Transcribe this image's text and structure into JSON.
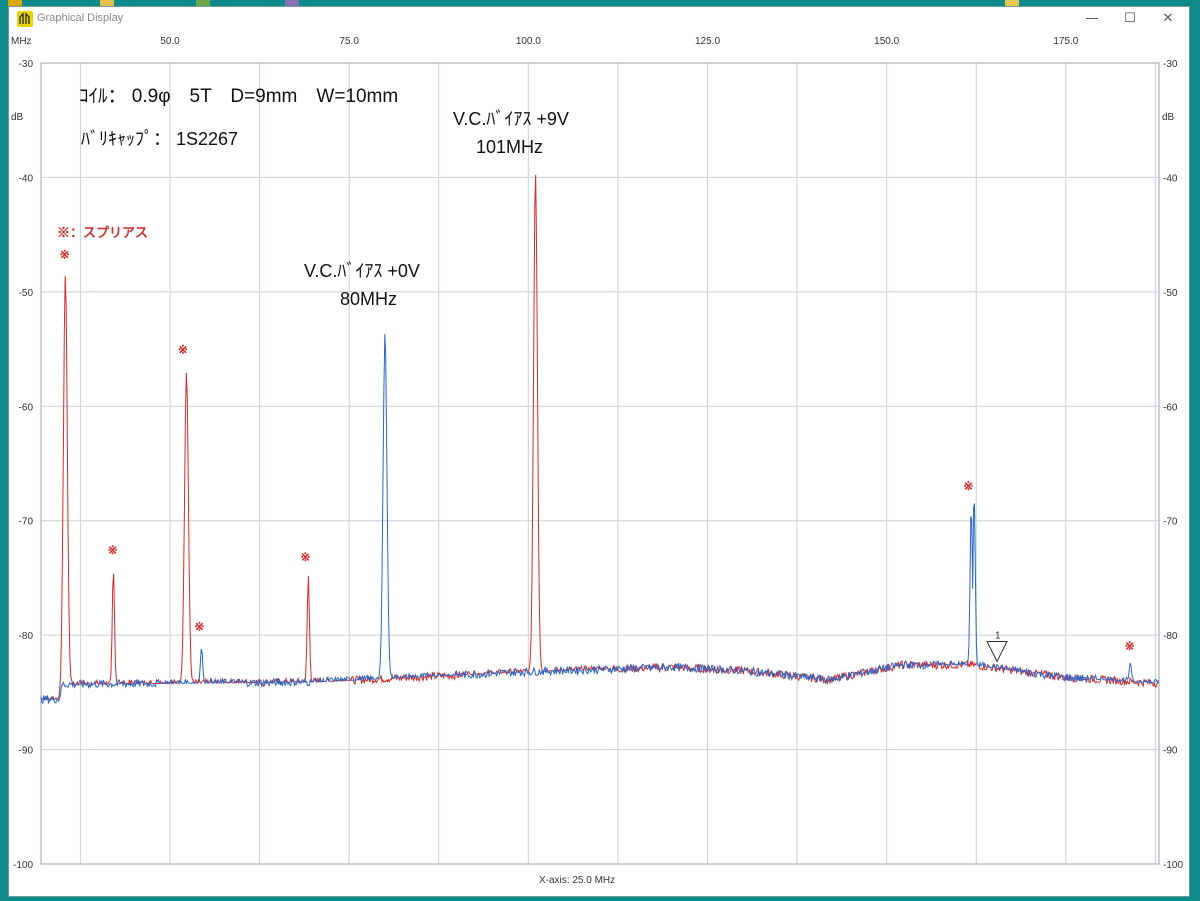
{
  "window": {
    "title": "Graphical Display",
    "minimize": "—",
    "maximize": "☐",
    "close": "✕"
  },
  "chart_data": {
    "type": "line",
    "x_unit": "MHz",
    "y_unit": "dB",
    "xlim": [
      32,
      188
    ],
    "ylim": [
      -100,
      -30
    ],
    "x_ticks": [
      50,
      75,
      100,
      125,
      150,
      175
    ],
    "x_tick_labels": [
      "50.0",
      "75.0",
      "100.0",
      "125.0",
      "150.0",
      "175.0"
    ],
    "y_ticks": [
      -30,
      -40,
      -50,
      -60,
      -70,
      -80,
      -90,
      -100
    ],
    "y_tick_labels": [
      "-30",
      "-40",
      "-50",
      "-60",
      "-70",
      "-80",
      "-90",
      "-100"
    ],
    "x_axis_label": "X-axis: 25.0 MHz",
    "grid": true,
    "series": [
      {
        "color": "#d42a2a",
        "noise_floor": [
          [
            32,
            -85.6
          ],
          [
            34.5,
            -85.6
          ],
          [
            35,
            -84.3
          ],
          [
            70,
            -84.1
          ],
          [
            100,
            -83.2
          ],
          [
            120,
            -82.8
          ],
          [
            130,
            -83.1
          ],
          [
            142,
            -83.9
          ],
          [
            152,
            -82.6
          ],
          [
            162,
            -82.6
          ],
          [
            175,
            -83.7
          ],
          [
            188,
            -84.2
          ]
        ],
        "peaks": [
          {
            "x": 35.4,
            "y": -48.5
          },
          {
            "x": 42.1,
            "y": -74.3
          },
          {
            "x": 52.3,
            "y": -57.0
          },
          {
            "x": 69.3,
            "y": -74.8
          },
          {
            "x": 101.0,
            "y": -39.5
          }
        ]
      },
      {
        "color": "#2a66c8",
        "noise_floor": [
          [
            32,
            -85.6
          ],
          [
            34.5,
            -85.6
          ],
          [
            35,
            -84.3
          ],
          [
            70,
            -84.1
          ],
          [
            100,
            -83.2
          ],
          [
            120,
            -82.8
          ],
          [
            130,
            -83.1
          ],
          [
            142,
            -83.9
          ],
          [
            152,
            -82.6
          ],
          [
            162,
            -82.6
          ],
          [
            175,
            -83.7
          ],
          [
            188,
            -84.2
          ]
        ],
        "peaks": [
          {
            "x": 54.4,
            "y": -81.1
          },
          {
            "x": 80.0,
            "y": -53.5
          },
          {
            "x": 161.8,
            "y": -68.6
          },
          {
            "x": 162.2,
            "y": -67.4
          },
          {
            "x": 184.0,
            "y": -82.4
          }
        ]
      }
    ],
    "spur_markers": [
      {
        "x": 35.3,
        "y": -47.1
      },
      {
        "x": 42.0,
        "y": -72.9
      },
      {
        "x": 51.8,
        "y": -55.4
      },
      {
        "x": 54.1,
        "y": -79.6
      },
      {
        "x": 68.9,
        "y": -73.5
      },
      {
        "x": 161.4,
        "y": -67.3
      },
      {
        "x": 183.9,
        "y": -81.3
      }
    ],
    "marker_symbol": "※",
    "marker_1": {
      "x": 165.4,
      "y": -82.3,
      "label": "1"
    },
    "annotations": {
      "coil": "ｺｲﾙ： 0.9φ　5T　D=9mm　W=10mm",
      "varicap": "ﾊﾞﾘｷｬｯﾌﾟ： 1S2267",
      "spurious_legend": "※：スプリアス",
      "vc9_line1": "V.C.ﾊﾞｲｱｽ +9V",
      "vc9_line2": "101MHz",
      "vc0_line1": "V.C.ﾊﾞｲｱｽ +0V",
      "vc0_line2": "80MHz"
    },
    "colors": {
      "red_series": "#d42a2a",
      "blue_series": "#2a66c8",
      "grid": "#c8d2d8",
      "axis_text": "#333333"
    }
  }
}
